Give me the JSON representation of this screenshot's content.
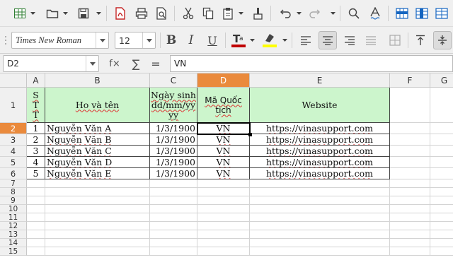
{
  "toolbar": {
    "font_name": "Times New Roman",
    "font_size": "12"
  },
  "formula_bar": {
    "name_box": "D2",
    "function_wizard": "f×",
    "sum": "∑",
    "equals": "=",
    "content": "VN"
  },
  "sheet": {
    "columns": [
      "A",
      "B",
      "C",
      "D",
      "E",
      "F",
      "G"
    ],
    "selected_column": "D",
    "selected_row": "2",
    "selected_cell": "D2",
    "header_row": {
      "stt": "STT",
      "name": "Ho và tên",
      "dob": "Ngày sinh dd/mm/yyyy",
      "country": "Mã Quốc tịch",
      "website": "Website"
    },
    "rows": [
      {
        "num": "2",
        "stt": "1",
        "name": "Nguyễn Văn A",
        "dob": "1/3/1900",
        "country": "VN",
        "website": "https://vinasupport.com"
      },
      {
        "num": "3",
        "stt": "2",
        "name": "Nguyễn Văn B",
        "dob": "1/3/1900",
        "country": "VN",
        "website": "https://vinasupport.com"
      },
      {
        "num": "4",
        "stt": "3",
        "name": "Nguyễn Văn C",
        "dob": "1/3/1900",
        "country": "VN",
        "website": "https://vinasupport.com"
      },
      {
        "num": "5",
        "stt": "4",
        "name": "Nguyễn Văn D",
        "dob": "1/3/1900",
        "country": "VN",
        "website": "https://vinasupport.com"
      },
      {
        "num": "6",
        "stt": "5",
        "name": "Nguyễn Văn E",
        "dob": "1/3/1900",
        "country": "VN",
        "website": "https://vinasupport.com"
      }
    ],
    "empty_rows": [
      "7",
      "8",
      "9",
      "10",
      "11",
      "12",
      "13",
      "14",
      "15"
    ],
    "header_fill": "#ccf5cc",
    "selection_color": "#ea8a3c"
  },
  "icons": {
    "font_color_swatch": "#c00000",
    "highlight_swatch": "#ffff00"
  }
}
